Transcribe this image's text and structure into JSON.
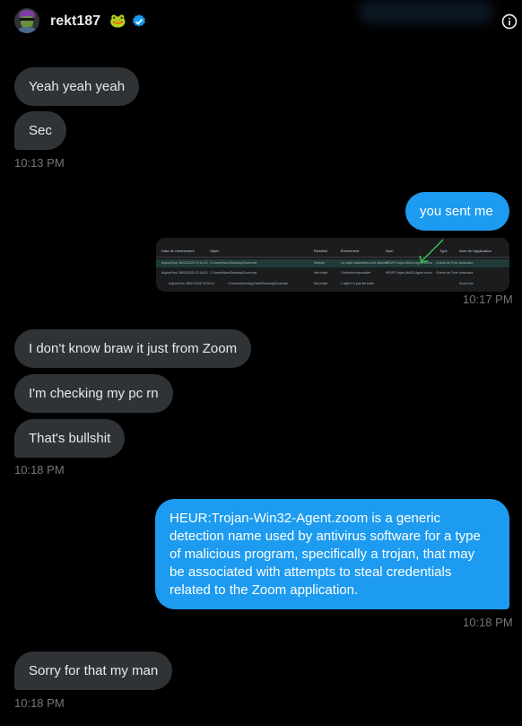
{
  "header": {
    "username": "rekt187",
    "emoji": "🐸"
  },
  "messages": {
    "m1": "Yeah yeah yeah",
    "m2": "Sec",
    "t1": "10:13 PM",
    "m3": "you sent me",
    "t2": "10:17 PM",
    "m4": "I don't know braw it just from Zoom",
    "m5": "I'm checking my pc rn",
    "m6": "That's bullshit",
    "t3": "10:18 PM",
    "m7_lines": [
      "HEUR:Trojan-Win32-Agent.zoom is a generic",
      "detection name used by antivirus software for a type",
      "of malicious program, specifically a trojan, that may",
      "be associated with attempts to steal credentials",
      "related to the Zoom application."
    ],
    "t4": "10:18 PM",
    "m8": "Sorry for that my man",
    "t5": "10:18 PM"
  },
  "screenshot": {
    "headers": [
      "Date de l'événement",
      "Objet",
      "Résultat",
      "Événement",
      "Nom",
      "Type",
      "Nom de l'application"
    ],
    "rows": [
      [
        "Aujourd'hui, 08/01/2025 22:16:23",
        "C:\\Users\\Nom\\Desktop\\Zoom.exe",
        "Détecté",
        "Un objet malveillant a été détecté",
        "HEUR:Trojan-Win32-Agent.zoom",
        "Cheval de Troie",
        "Ansevaux"
      ],
      [
        "Aujourd'hui, 08/01/2025 22:16:23",
        "C:\\Users\\Nom\\Desktop\\Zoom.exe",
        "Non traité",
        "L'infection impossible",
        "HEUR:Trojan-Win32-Agent.zoom",
        "Cheval de Troie",
        "Ansevaux"
      ],
      [
        "Aujourd'hui, 08/01/2025 22:04:11",
        "C:\\Users\\Nom\\AppData\\Roaming\\Zoom\\bin",
        "Non traité",
        "L'objet n'a pas été traité",
        "",
        "",
        "Zoom.exe"
      ]
    ]
  },
  "colors": {
    "accent": "#1d9bf0",
    "incoming": "#2f3336",
    "background": "#000000"
  }
}
